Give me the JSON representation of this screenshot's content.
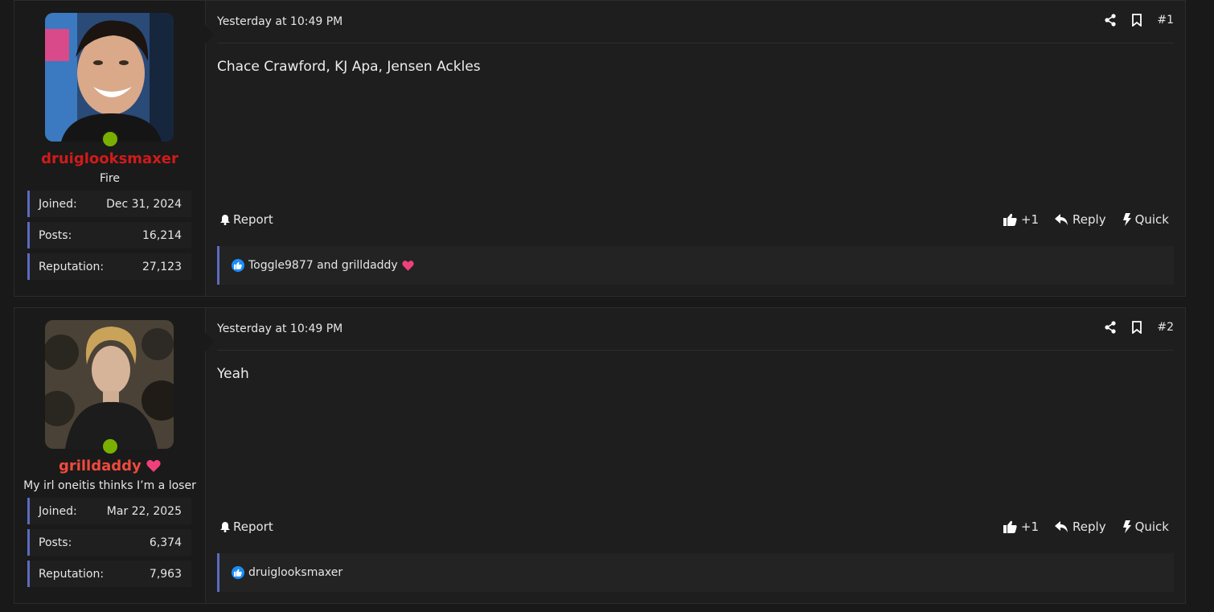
{
  "colors": {
    "background": "#191919",
    "post_bg": "#1e1e1e",
    "accent_border": "#5c6bc0",
    "online": "#79b000",
    "username_red": "#d21a1a",
    "username_orange": "#ef4a3c",
    "heart": "#f0407c",
    "like_blue": "#1a8ef7"
  },
  "posts": [
    {
      "username": "druiglooksmaxer",
      "user_title": "Fire",
      "stats": {
        "joined_label": "Joined:",
        "joined": "Dec 31, 2024",
        "posts_label": "Posts:",
        "posts": "16,214",
        "rep_label": "Reputation:",
        "rep": "27,123"
      },
      "date": "Yesterday at 10:49 PM",
      "number": "#1",
      "content": "Chace Crawford, KJ Apa, Jensen Ackles",
      "report": "Report",
      "like": "+1",
      "reply": "Reply",
      "quick": "Quick",
      "reactions": "Toggle9877 and grilldaddy"
    },
    {
      "username": "grilldaddy",
      "user_title": "My irl oneitis thinks I’m a loser",
      "stats": {
        "joined_label": "Joined:",
        "joined": "Mar 22, 2025",
        "posts_label": "Posts:",
        "posts": "6,374",
        "rep_label": "Reputation:",
        "rep": "7,963"
      },
      "date": "Yesterday at 10:49 PM",
      "number": "#2",
      "content": "Yeah",
      "report": "Report",
      "like": "+1",
      "reply": "Reply",
      "quick": "Quick",
      "reactions": "druiglooksmaxer"
    }
  ]
}
